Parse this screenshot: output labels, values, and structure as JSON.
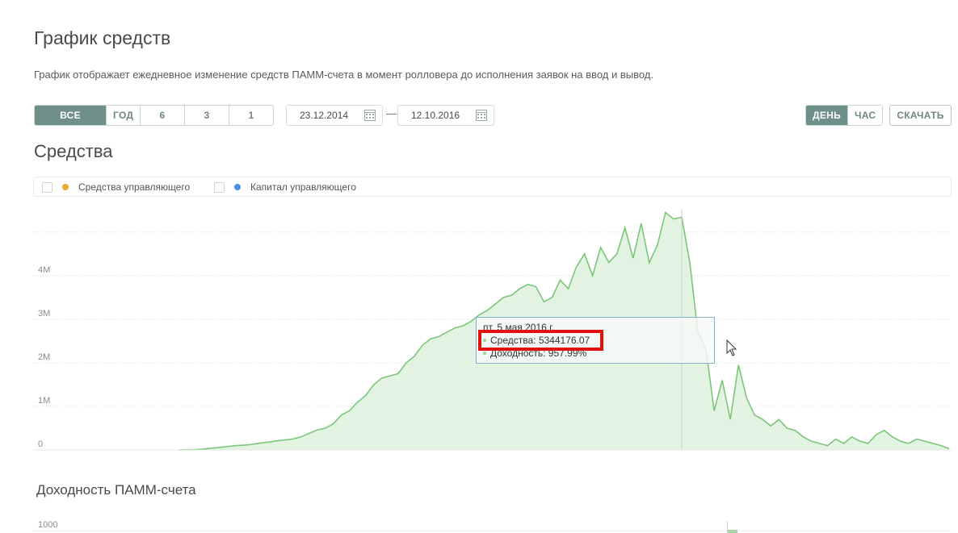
{
  "page": {
    "title": "График средств",
    "description": "График отображает ежедневное изменение средств ПАММ-счета в момент ролловера до исполнения заявок на ввод и вывод."
  },
  "period_buttons": [
    {
      "label": "ВСЕ ВРЕМЯ",
      "active": true
    },
    {
      "label": "ГОД",
      "active": false
    },
    {
      "label": "6 МЕС",
      "active": false
    },
    {
      "label": "3 МЕС",
      "active": false
    },
    {
      "label": "1 МЕС",
      "active": false
    }
  ],
  "date_range": {
    "from": "23.12.2014",
    "separator": "—",
    "to": "12.10.2016"
  },
  "granularity_buttons": [
    {
      "label": "ДЕНЬ",
      "active": true
    },
    {
      "label": "ЧАС",
      "active": false
    }
  ],
  "download_label": "СКАЧАТЬ",
  "section_title": "Средства",
  "legend": [
    {
      "label": "Средства управляющего",
      "color": "#f0a830"
    },
    {
      "label": "Капитал управляющего",
      "color": "#4a8fd9"
    }
  ],
  "tooltip": {
    "date": "пт, 5 мая 2016 г.",
    "funds": "Средства: 5344176.07",
    "yield": "Доходность: 957.99%"
  },
  "section2_title": "Доходность ПАММ-счета",
  "chart2_y_label": "1000",
  "colors": {
    "line": "#7cc67a",
    "area": "#e3f3e2",
    "accent": "#6f8f8b",
    "highlight": "#e20f0f"
  },
  "chart_data": {
    "type": "area",
    "title": "Средства",
    "y_ticks": [
      "0",
      "1M",
      "2M",
      "3M",
      "4M"
    ],
    "ylim": [
      0,
      5700000
    ],
    "x_date_range": [
      "23.12.2014",
      "12.10.2016"
    ],
    "grid": true,
    "series": [
      {
        "name": "Средства",
        "values": [
          0,
          5000,
          10000,
          20000,
          40000,
          60000,
          80000,
          100000,
          110000,
          130000,
          160000,
          180000,
          210000,
          230000,
          250000,
          300000,
          380000,
          460000,
          500000,
          600000,
          800000,
          900000,
          1100000,
          1250000,
          1500000,
          1650000,
          1700000,
          1750000,
          2000000,
          2150000,
          2400000,
          2550000,
          2600000,
          2700000,
          2800000,
          2850000,
          2950000,
          3100000,
          3200000,
          3350000,
          3500000,
          3550000,
          3700000,
          3800000,
          3750000,
          3400000,
          3500000,
          3900000,
          3700000,
          4200000,
          4500000,
          4000000,
          4650000,
          4300000,
          4500000,
          5100000,
          4400000,
          5200000,
          4300000,
          4700000,
          5450000,
          5300000,
          5344176,
          4300000,
          2700000,
          2300000,
          900000,
          1600000,
          700000,
          1950000,
          1200000,
          800000,
          700000,
          550000,
          700000,
          500000,
          450000,
          300000,
          200000,
          150000,
          100000,
          250000,
          150000,
          300000,
          200000,
          150000,
          350000,
          450000,
          300000,
          200000,
          150000,
          250000,
          200000,
          150000,
          100000,
          30000
        ]
      }
    ]
  }
}
